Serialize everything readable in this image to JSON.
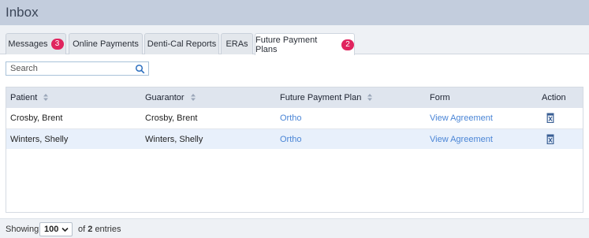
{
  "header": {
    "title": "Inbox"
  },
  "tabs": [
    {
      "label": "Messages",
      "badge": "3"
    },
    {
      "label": "Online Payments"
    },
    {
      "label": "Denti-Cal Reports"
    },
    {
      "label": "ERAs"
    },
    {
      "label": "Future Payment Plans",
      "badge": "2",
      "active": true
    }
  ],
  "search": {
    "placeholder": "Search",
    "icon": "search-icon"
  },
  "table": {
    "columns": [
      "Patient",
      "Guarantor",
      "Future Payment Plan",
      "Form",
      "Action"
    ],
    "rows": [
      {
        "patient": "Crosby, Brent",
        "guarantor": "Crosby, Brent",
        "plan": "Ortho",
        "form": "View Agreement",
        "action_icon": "delete-icon"
      },
      {
        "patient": "Winters, Shelly",
        "guarantor": "Winters, Shelly",
        "plan": "Ortho",
        "form": "View Agreement",
        "action_icon": "delete-icon"
      }
    ]
  },
  "footer": {
    "showing": "Showing",
    "page_size": "100",
    "of": "of",
    "count": "2",
    "entries": "entries"
  },
  "colors": {
    "badge": "#e0245e",
    "link": "#4a85d6",
    "header_bar": "#c3cddd"
  }
}
